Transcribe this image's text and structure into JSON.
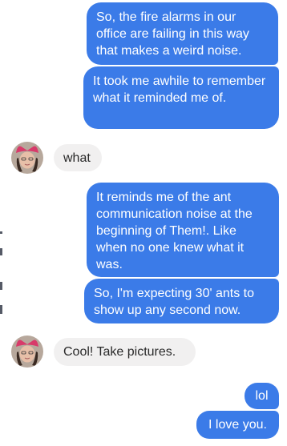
{
  "messages": [
    {
      "sender": "me",
      "text": "So, the fire alarms in our office are failing in this way that makes a weird noise."
    },
    {
      "sender": "me",
      "text": "It took me awhile to remember what it reminded me of."
    },
    {
      "sender": "them",
      "text": "what",
      "avatar": "user-avatar-icon"
    },
    {
      "sender": "me",
      "text": "It reminds me of the ant communication noise at the beginning of Them!. Like when no one knew what it was."
    },
    {
      "sender": "me",
      "text": "So, I'm expecting 30' ants to show up any second now."
    },
    {
      "sender": "them",
      "text": "Cool! Take pictures.",
      "avatar": "user-avatar-icon"
    },
    {
      "sender": "me",
      "text": "lol"
    },
    {
      "sender": "me",
      "text": "I love you."
    }
  ],
  "colors": {
    "outgoing_bubble": "#3b7be8",
    "incoming_bubble": "#f1f0f0",
    "outgoing_text": "#ffffff",
    "incoming_text": "#2a2a2a"
  }
}
